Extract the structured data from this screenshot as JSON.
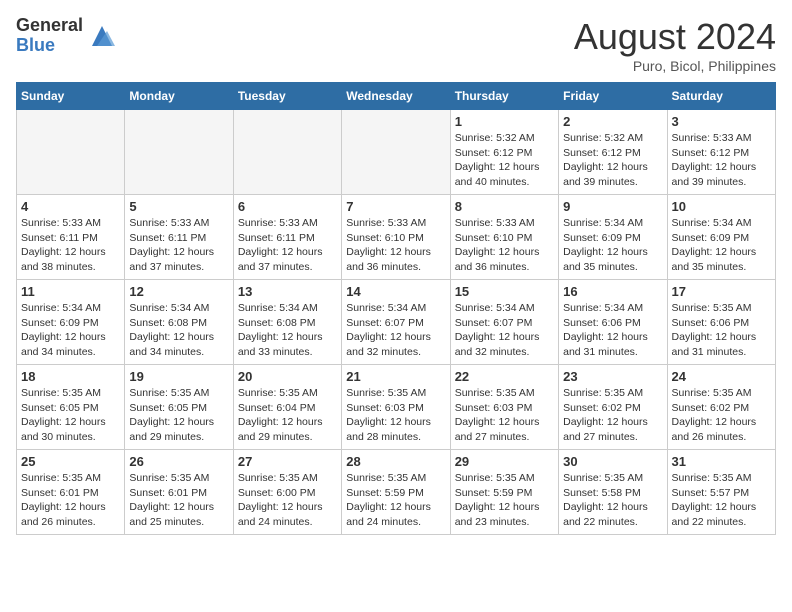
{
  "header": {
    "logo_general": "General",
    "logo_blue": "Blue",
    "month_year": "August 2024",
    "location": "Puro, Bicol, Philippines"
  },
  "days_of_week": [
    "Sunday",
    "Monday",
    "Tuesday",
    "Wednesday",
    "Thursday",
    "Friday",
    "Saturday"
  ],
  "weeks": [
    [
      {
        "day": "",
        "empty": true
      },
      {
        "day": "",
        "empty": true
      },
      {
        "day": "",
        "empty": true
      },
      {
        "day": "",
        "empty": true
      },
      {
        "day": "1",
        "sunrise": "5:32 AM",
        "sunset": "6:12 PM",
        "daylight": "12 hours and 40 minutes."
      },
      {
        "day": "2",
        "sunrise": "5:32 AM",
        "sunset": "6:12 PM",
        "daylight": "12 hours and 39 minutes."
      },
      {
        "day": "3",
        "sunrise": "5:33 AM",
        "sunset": "6:12 PM",
        "daylight": "12 hours and 39 minutes."
      }
    ],
    [
      {
        "day": "4",
        "sunrise": "5:33 AM",
        "sunset": "6:11 PM",
        "daylight": "12 hours and 38 minutes."
      },
      {
        "day": "5",
        "sunrise": "5:33 AM",
        "sunset": "6:11 PM",
        "daylight": "12 hours and 37 minutes."
      },
      {
        "day": "6",
        "sunrise": "5:33 AM",
        "sunset": "6:11 PM",
        "daylight": "12 hours and 37 minutes."
      },
      {
        "day": "7",
        "sunrise": "5:33 AM",
        "sunset": "6:10 PM",
        "daylight": "12 hours and 36 minutes."
      },
      {
        "day": "8",
        "sunrise": "5:33 AM",
        "sunset": "6:10 PM",
        "daylight": "12 hours and 36 minutes."
      },
      {
        "day": "9",
        "sunrise": "5:34 AM",
        "sunset": "6:09 PM",
        "daylight": "12 hours and 35 minutes."
      },
      {
        "day": "10",
        "sunrise": "5:34 AM",
        "sunset": "6:09 PM",
        "daylight": "12 hours and 35 minutes."
      }
    ],
    [
      {
        "day": "11",
        "sunrise": "5:34 AM",
        "sunset": "6:09 PM",
        "daylight": "12 hours and 34 minutes."
      },
      {
        "day": "12",
        "sunrise": "5:34 AM",
        "sunset": "6:08 PM",
        "daylight": "12 hours and 34 minutes."
      },
      {
        "day": "13",
        "sunrise": "5:34 AM",
        "sunset": "6:08 PM",
        "daylight": "12 hours and 33 minutes."
      },
      {
        "day": "14",
        "sunrise": "5:34 AM",
        "sunset": "6:07 PM",
        "daylight": "12 hours and 32 minutes."
      },
      {
        "day": "15",
        "sunrise": "5:34 AM",
        "sunset": "6:07 PM",
        "daylight": "12 hours and 32 minutes."
      },
      {
        "day": "16",
        "sunrise": "5:34 AM",
        "sunset": "6:06 PM",
        "daylight": "12 hours and 31 minutes."
      },
      {
        "day": "17",
        "sunrise": "5:35 AM",
        "sunset": "6:06 PM",
        "daylight": "12 hours and 31 minutes."
      }
    ],
    [
      {
        "day": "18",
        "sunrise": "5:35 AM",
        "sunset": "6:05 PM",
        "daylight": "12 hours and 30 minutes."
      },
      {
        "day": "19",
        "sunrise": "5:35 AM",
        "sunset": "6:05 PM",
        "daylight": "12 hours and 29 minutes."
      },
      {
        "day": "20",
        "sunrise": "5:35 AM",
        "sunset": "6:04 PM",
        "daylight": "12 hours and 29 minutes."
      },
      {
        "day": "21",
        "sunrise": "5:35 AM",
        "sunset": "6:03 PM",
        "daylight": "12 hours and 28 minutes."
      },
      {
        "day": "22",
        "sunrise": "5:35 AM",
        "sunset": "6:03 PM",
        "daylight": "12 hours and 27 minutes."
      },
      {
        "day": "23",
        "sunrise": "5:35 AM",
        "sunset": "6:02 PM",
        "daylight": "12 hours and 27 minutes."
      },
      {
        "day": "24",
        "sunrise": "5:35 AM",
        "sunset": "6:02 PM",
        "daylight": "12 hours and 26 minutes."
      }
    ],
    [
      {
        "day": "25",
        "sunrise": "5:35 AM",
        "sunset": "6:01 PM",
        "daylight": "12 hours and 26 minutes."
      },
      {
        "day": "26",
        "sunrise": "5:35 AM",
        "sunset": "6:01 PM",
        "daylight": "12 hours and 25 minutes."
      },
      {
        "day": "27",
        "sunrise": "5:35 AM",
        "sunset": "6:00 PM",
        "daylight": "12 hours and 24 minutes."
      },
      {
        "day": "28",
        "sunrise": "5:35 AM",
        "sunset": "5:59 PM",
        "daylight": "12 hours and 24 minutes."
      },
      {
        "day": "29",
        "sunrise": "5:35 AM",
        "sunset": "5:59 PM",
        "daylight": "12 hours and 23 minutes."
      },
      {
        "day": "30",
        "sunrise": "5:35 AM",
        "sunset": "5:58 PM",
        "daylight": "12 hours and 22 minutes."
      },
      {
        "day": "31",
        "sunrise": "5:35 AM",
        "sunset": "5:57 PM",
        "daylight": "12 hours and 22 minutes."
      }
    ]
  ]
}
